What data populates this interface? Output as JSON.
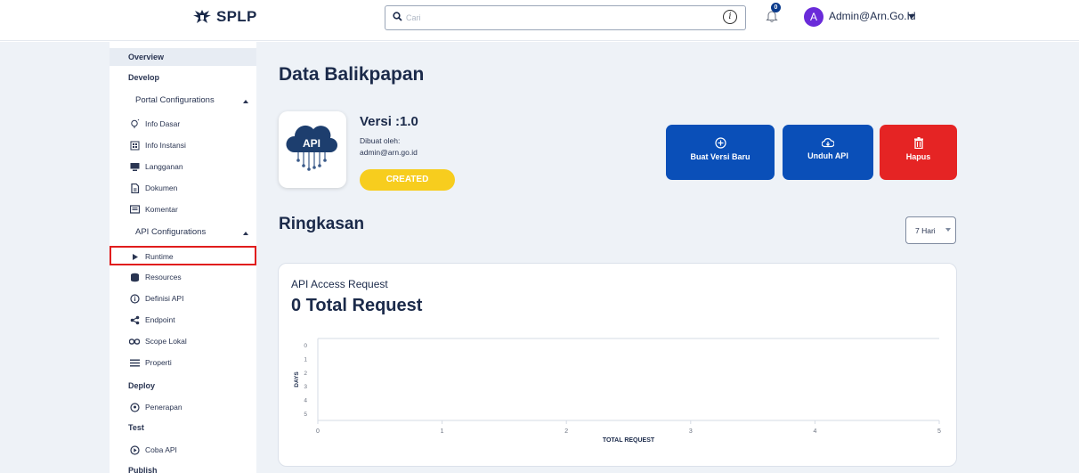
{
  "header": {
    "app_name": "SPLP",
    "search_placeholder": "Cari",
    "notification_count": "0",
    "avatar_initial": "A",
    "user_name": "Admin@Arn.Go.Id"
  },
  "sidebar": {
    "overview": "Overview",
    "develop": "Develop",
    "portal_config": "Portal Configurations",
    "portal_items": [
      {
        "label": "Info Dasar",
        "icon": "lightbulb-icon"
      },
      {
        "label": "Info Instansi",
        "icon": "building-icon"
      },
      {
        "label": "Langganan",
        "icon": "monitor-icon"
      },
      {
        "label": "Dokumen",
        "icon": "document-icon"
      },
      {
        "label": "Komentar",
        "icon": "comment-icon"
      }
    ],
    "api_config": "API Configurations",
    "api_items": [
      {
        "label": "Runtime",
        "icon": "play-icon"
      },
      {
        "label": "Resources",
        "icon": "database-icon"
      },
      {
        "label": "Definisi API",
        "icon": "info-icon"
      },
      {
        "label": "Endpoint",
        "icon": "network-icon"
      },
      {
        "label": "Scope Lokal",
        "icon": "key-icon"
      },
      {
        "label": "Properti",
        "icon": "list-icon"
      }
    ],
    "deploy": "Deploy",
    "deploy_item": "Penerapan",
    "test": "Test",
    "test_item": "Coba API",
    "publish": "Publish"
  },
  "main": {
    "title": "Data Balikpapan",
    "api_logo_text": "API",
    "version": "Versi :1.0",
    "created_by_label": "Dibuat oleh:",
    "created_by": "admin@arn.go.id",
    "status": "CREATED",
    "buttons": {
      "new_version": "Buat Versi Baru",
      "download": "Unduh API",
      "delete": "Hapus"
    },
    "summary_title": "Ringkasan",
    "period": "7 Hari"
  },
  "chart_data": {
    "type": "bar",
    "orientation": "horizontal",
    "title": "API Access Request",
    "subtitle": "0 Total Request",
    "xlabel": "TOTAL REQUEST",
    "ylabel": "DAYS",
    "x_ticks": [
      "0",
      "1",
      "2",
      "3",
      "4",
      "5"
    ],
    "y_ticks": [
      "0",
      "1",
      "2",
      "3",
      "4",
      "5"
    ],
    "xlim": [
      0,
      5
    ],
    "categories": [
      0,
      1,
      2,
      3,
      4,
      5
    ],
    "values": [
      0,
      0,
      0,
      0,
      0,
      0
    ],
    "grid": false,
    "colors": {
      "axis": "#d5dbe4",
      "tick": "#6b7280"
    }
  },
  "colors": {
    "primary": "#0a4fb8",
    "danger": "#e52424",
    "status": "#f7cd1e",
    "highlight": "#e11d1d",
    "avatar": "#6a2bd9"
  }
}
